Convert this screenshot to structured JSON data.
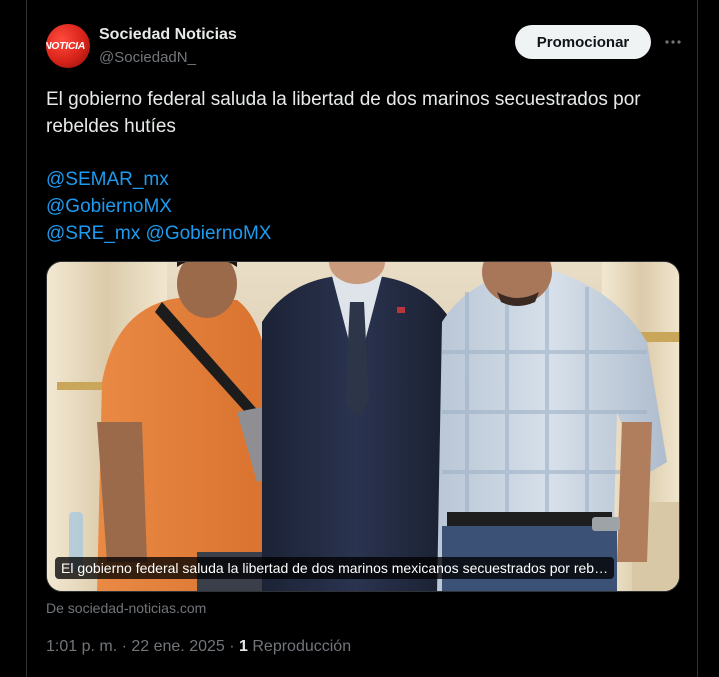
{
  "author": {
    "name": "Sociedad Noticias",
    "handle": "@SociedadN_",
    "avatar_text": "NOTICIA"
  },
  "actions": {
    "promote_label": "Promocionar"
  },
  "tweet": {
    "text": "El gobierno federal saluda la libertad de dos marinos secuestrados por rebeldes hutíes",
    "mentions": [
      "@SEMAR_mx",
      "@GobiernoMX",
      "@SRE_mx",
      "@GobiernoMX"
    ]
  },
  "media": {
    "caption": "El gobierno federal saluda la libertad de dos marinos mexicanos secuestrados por reb…",
    "source": "De sociedad-noticias.com"
  },
  "meta": {
    "time": "1:01 p. m. · 22 ene. 2025 · ",
    "views_count": "1",
    "views_label": " Reproducción"
  },
  "colors": {
    "background": "#000000",
    "text": "#e7e9ea",
    "muted": "#71767b",
    "link": "#1d9bf0",
    "button_bg": "#eff3f4",
    "avatar_red": "#d8231a"
  }
}
